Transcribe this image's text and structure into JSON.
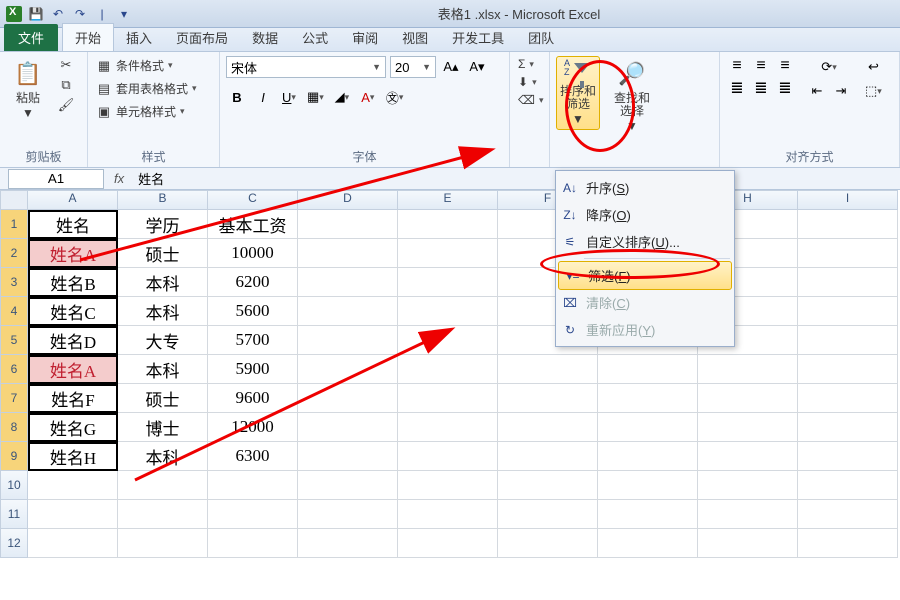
{
  "title": "表格1 .xlsx - Microsoft Excel",
  "tabs": {
    "file": "文件",
    "home": "开始",
    "insert": "插入",
    "layout": "页面布局",
    "data": "数据",
    "formulas": "公式",
    "review": "审阅",
    "view": "视图",
    "dev": "开发工具",
    "team": "团队"
  },
  "groups": {
    "clipboard": "剪贴板",
    "styles": "样式",
    "font": "字体",
    "align": "对齐方式"
  },
  "clipboard": {
    "paste": "粘贴"
  },
  "styles": {
    "cond": "条件格式",
    "table": "套用表格格式",
    "cell": "单元格样式"
  },
  "fontg": {
    "name": "宋体",
    "size": "20",
    "bold": "B",
    "italic": "I",
    "underline": "U"
  },
  "sigma": "Σ",
  "sort": {
    "label": "排序和筛选"
  },
  "find": {
    "label": "查找和选择"
  },
  "namebox": "A1",
  "formula": "姓名",
  "cols": [
    "A",
    "B",
    "C",
    "D",
    "E",
    "F",
    "G",
    "H",
    "I"
  ],
  "colw": {
    "A": 90,
    "B": 90,
    "C": 90,
    "D": 100,
    "E": 100,
    "F": 100,
    "G": 100,
    "H": 100,
    "I": 100
  },
  "rows": [
    {
      "A": "姓名",
      "B": "学历",
      "C": "基本工资"
    },
    {
      "A": "姓名A",
      "B": "硕士",
      "C": "10000",
      "Ared": true
    },
    {
      "A": "姓名B",
      "B": "本科",
      "C": "6200"
    },
    {
      "A": "姓名C",
      "B": "本科",
      "C": "5600"
    },
    {
      "A": "姓名D",
      "B": "大专",
      "C": "5700"
    },
    {
      "A": "姓名A",
      "B": "本科",
      "C": "5900",
      "Ared": true
    },
    {
      "A": "姓名F",
      "B": "硕士",
      "C": "9600"
    },
    {
      "A": "姓名G",
      "B": "博士",
      "C": "12000"
    },
    {
      "A": "姓名H",
      "B": "本科",
      "C": "6300"
    }
  ],
  "menu": {
    "asc": {
      "t": "升序(",
      "k": "S",
      "s": ")"
    },
    "desc": {
      "t": "降序(",
      "k": "O",
      "s": ")"
    },
    "custom": {
      "t": "自定义排序(",
      "k": "U",
      "s": ")..."
    },
    "filter": {
      "t": "筛选(",
      "k": "F",
      "s": ")"
    },
    "clear": {
      "t": "清除(",
      "k": "C",
      "s": ")"
    },
    "reapply": {
      "t": "重新应用(",
      "k": "Y",
      "s": ")"
    }
  }
}
